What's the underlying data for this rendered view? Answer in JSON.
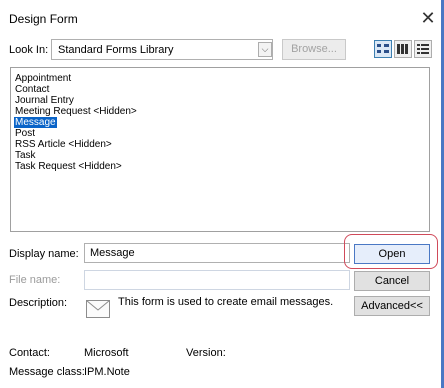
{
  "window": {
    "title": "Design Form"
  },
  "look_in": {
    "label": "Look In:",
    "value": "Standard Forms Library"
  },
  "browse": {
    "label": "Browse..."
  },
  "forms_list": {
    "items": [
      {
        "label": "Appointment",
        "selected": false
      },
      {
        "label": "Contact",
        "selected": false
      },
      {
        "label": "Journal Entry",
        "selected": false
      },
      {
        "label": "Meeting Request <Hidden>",
        "selected": false
      },
      {
        "label": "Message",
        "selected": true
      },
      {
        "label": "Post",
        "selected": false
      },
      {
        "label": "RSS Article <Hidden>",
        "selected": false
      },
      {
        "label": "Task",
        "selected": false
      },
      {
        "label": "Task Request <Hidden>",
        "selected": false
      }
    ]
  },
  "display_name": {
    "label": "Display name:",
    "value": "Message"
  },
  "file_name": {
    "label": "File name:",
    "value": ""
  },
  "buttons": {
    "open": "Open",
    "cancel": "Cancel",
    "advanced": "Advanced<<"
  },
  "description": {
    "label": "Description:",
    "text": "This form is used to create email messages."
  },
  "details": {
    "contact_label": "Contact:",
    "contact_value": "Microsoft",
    "version_label": "Version:",
    "version_value": "",
    "message_class_label": "Message class:",
    "message_class_value": "IPM.Note"
  },
  "icons": {
    "close": "close-icon",
    "dropdown": "chevron-down-icon",
    "large_icons": "large-icons-view-icon",
    "small_icons": "small-icons-view-icon",
    "list": "list-view-icon",
    "envelope": "envelope-icon"
  },
  "colors": {
    "selection": "#0a64c8",
    "highlight_outline": "#d04a5a",
    "accent": "#4a78c4"
  }
}
